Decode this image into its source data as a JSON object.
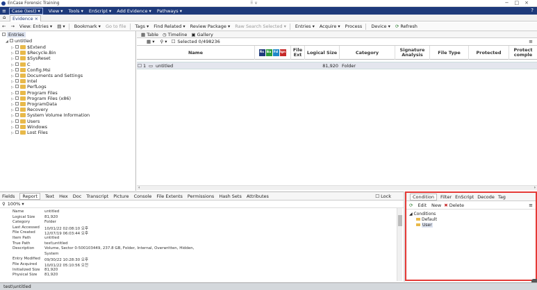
{
  "window": {
    "title": "EnCase Forensic Training",
    "center": "⠿ ∨"
  },
  "menu": {
    "items": [
      "Case (test) ▾",
      "View ▾",
      "Tools ▾",
      "EnScript ▾",
      "Add Evidence ▾",
      "Pathways ▾"
    ],
    "help": "?"
  },
  "tabs": {
    "home": "⌂",
    "evidence": "Evidence ×"
  },
  "toolbar": {
    "back": "←",
    "forward": "→",
    "view_entries": "View: Entries ▾",
    "split": "▤ ▾",
    "bookmark": "Bookmark ▾",
    "go_to_file": "Go to file",
    "tags": "Tags ▾",
    "find_related": "Find Related ▾",
    "review_package": "Review Package ▾",
    "raw_search": "Raw Search Selected ▾",
    "entries": "Entries ▾",
    "acquire": "Acquire ▾",
    "process": "Process",
    "device": "Device ▾",
    "refresh": "Refresh"
  },
  "tree": {
    "root": "Entries",
    "case": "untitled",
    "items": [
      "$Extend",
      "$Recycle.Bin",
      "$SysReset",
      "C",
      "Config.Msi",
      "Documents and Settings",
      "Intel",
      "PerfLogs",
      "Program Files",
      "Program Files (x86)",
      "ProgramData",
      "Recovery",
      "System Volume Information",
      "Users",
      "Windows",
      "Lost Files"
    ]
  },
  "grid": {
    "tabs": [
      "Table",
      "Timeline",
      "Gallery"
    ],
    "selected": "Selected 0/498236",
    "columns": [
      "Name",
      "File Ext",
      "Logical Size",
      "Category",
      "Signature Analysis",
      "File Type",
      "Protected",
      "Protect comple"
    ],
    "badges": [
      "Rs",
      "Ba",
      "Fd",
      "Ign"
    ],
    "rows": [
      {
        "num": "1",
        "name": "untitled",
        "size": "81,920",
        "category": "Folder"
      }
    ]
  },
  "bottom": {
    "tabs": [
      "Fields",
      "Report",
      "Text",
      "Hex",
      "Doc",
      "Transcript",
      "Picture",
      "Console",
      "File Extents",
      "Permissions",
      "Hash Sets",
      "Attributes"
    ],
    "lock": "Lock",
    "zoom": "100% ▾"
  },
  "report": {
    "rows": [
      {
        "k": "Name",
        "v": "untitled"
      },
      {
        "k": "Logical Size",
        "v": "81,920"
      },
      {
        "k": "Category",
        "v": "Folder"
      },
      {
        "k": "Last Accessed",
        "v": "10/01/22 02:08:10 오후"
      },
      {
        "k": "File Created",
        "v": "12/07/19 06:03:44 오후"
      },
      {
        "k": "Item Path",
        "v": "untitled"
      },
      {
        "k": "True Path",
        "v": "test\\untitled"
      },
      {
        "k": "Description",
        "v": "Volume, Sector 0-500103449, 237.8 GB, Folder, Internal, Overwritten, Hidden,"
      },
      {
        "k": "",
        "v": "System"
      },
      {
        "k": "Entry Modified",
        "v": "09/30/22 10:28:30 오후"
      },
      {
        "k": "File Acquired",
        "v": "10/01/22 05:10:56 오전"
      },
      {
        "k": "Initialized Size",
        "v": "81,920"
      },
      {
        "k": "Physical Size",
        "v": "81,920"
      }
    ]
  },
  "condition": {
    "tabs": [
      "Condition",
      "Filter",
      "EnScript",
      "Decode",
      "Tag"
    ],
    "tools": [
      "Edit",
      "New",
      "Delete"
    ],
    "root": "Conditions",
    "items": [
      "Default",
      "User"
    ]
  },
  "status": {
    "path": "test\\untitled"
  }
}
